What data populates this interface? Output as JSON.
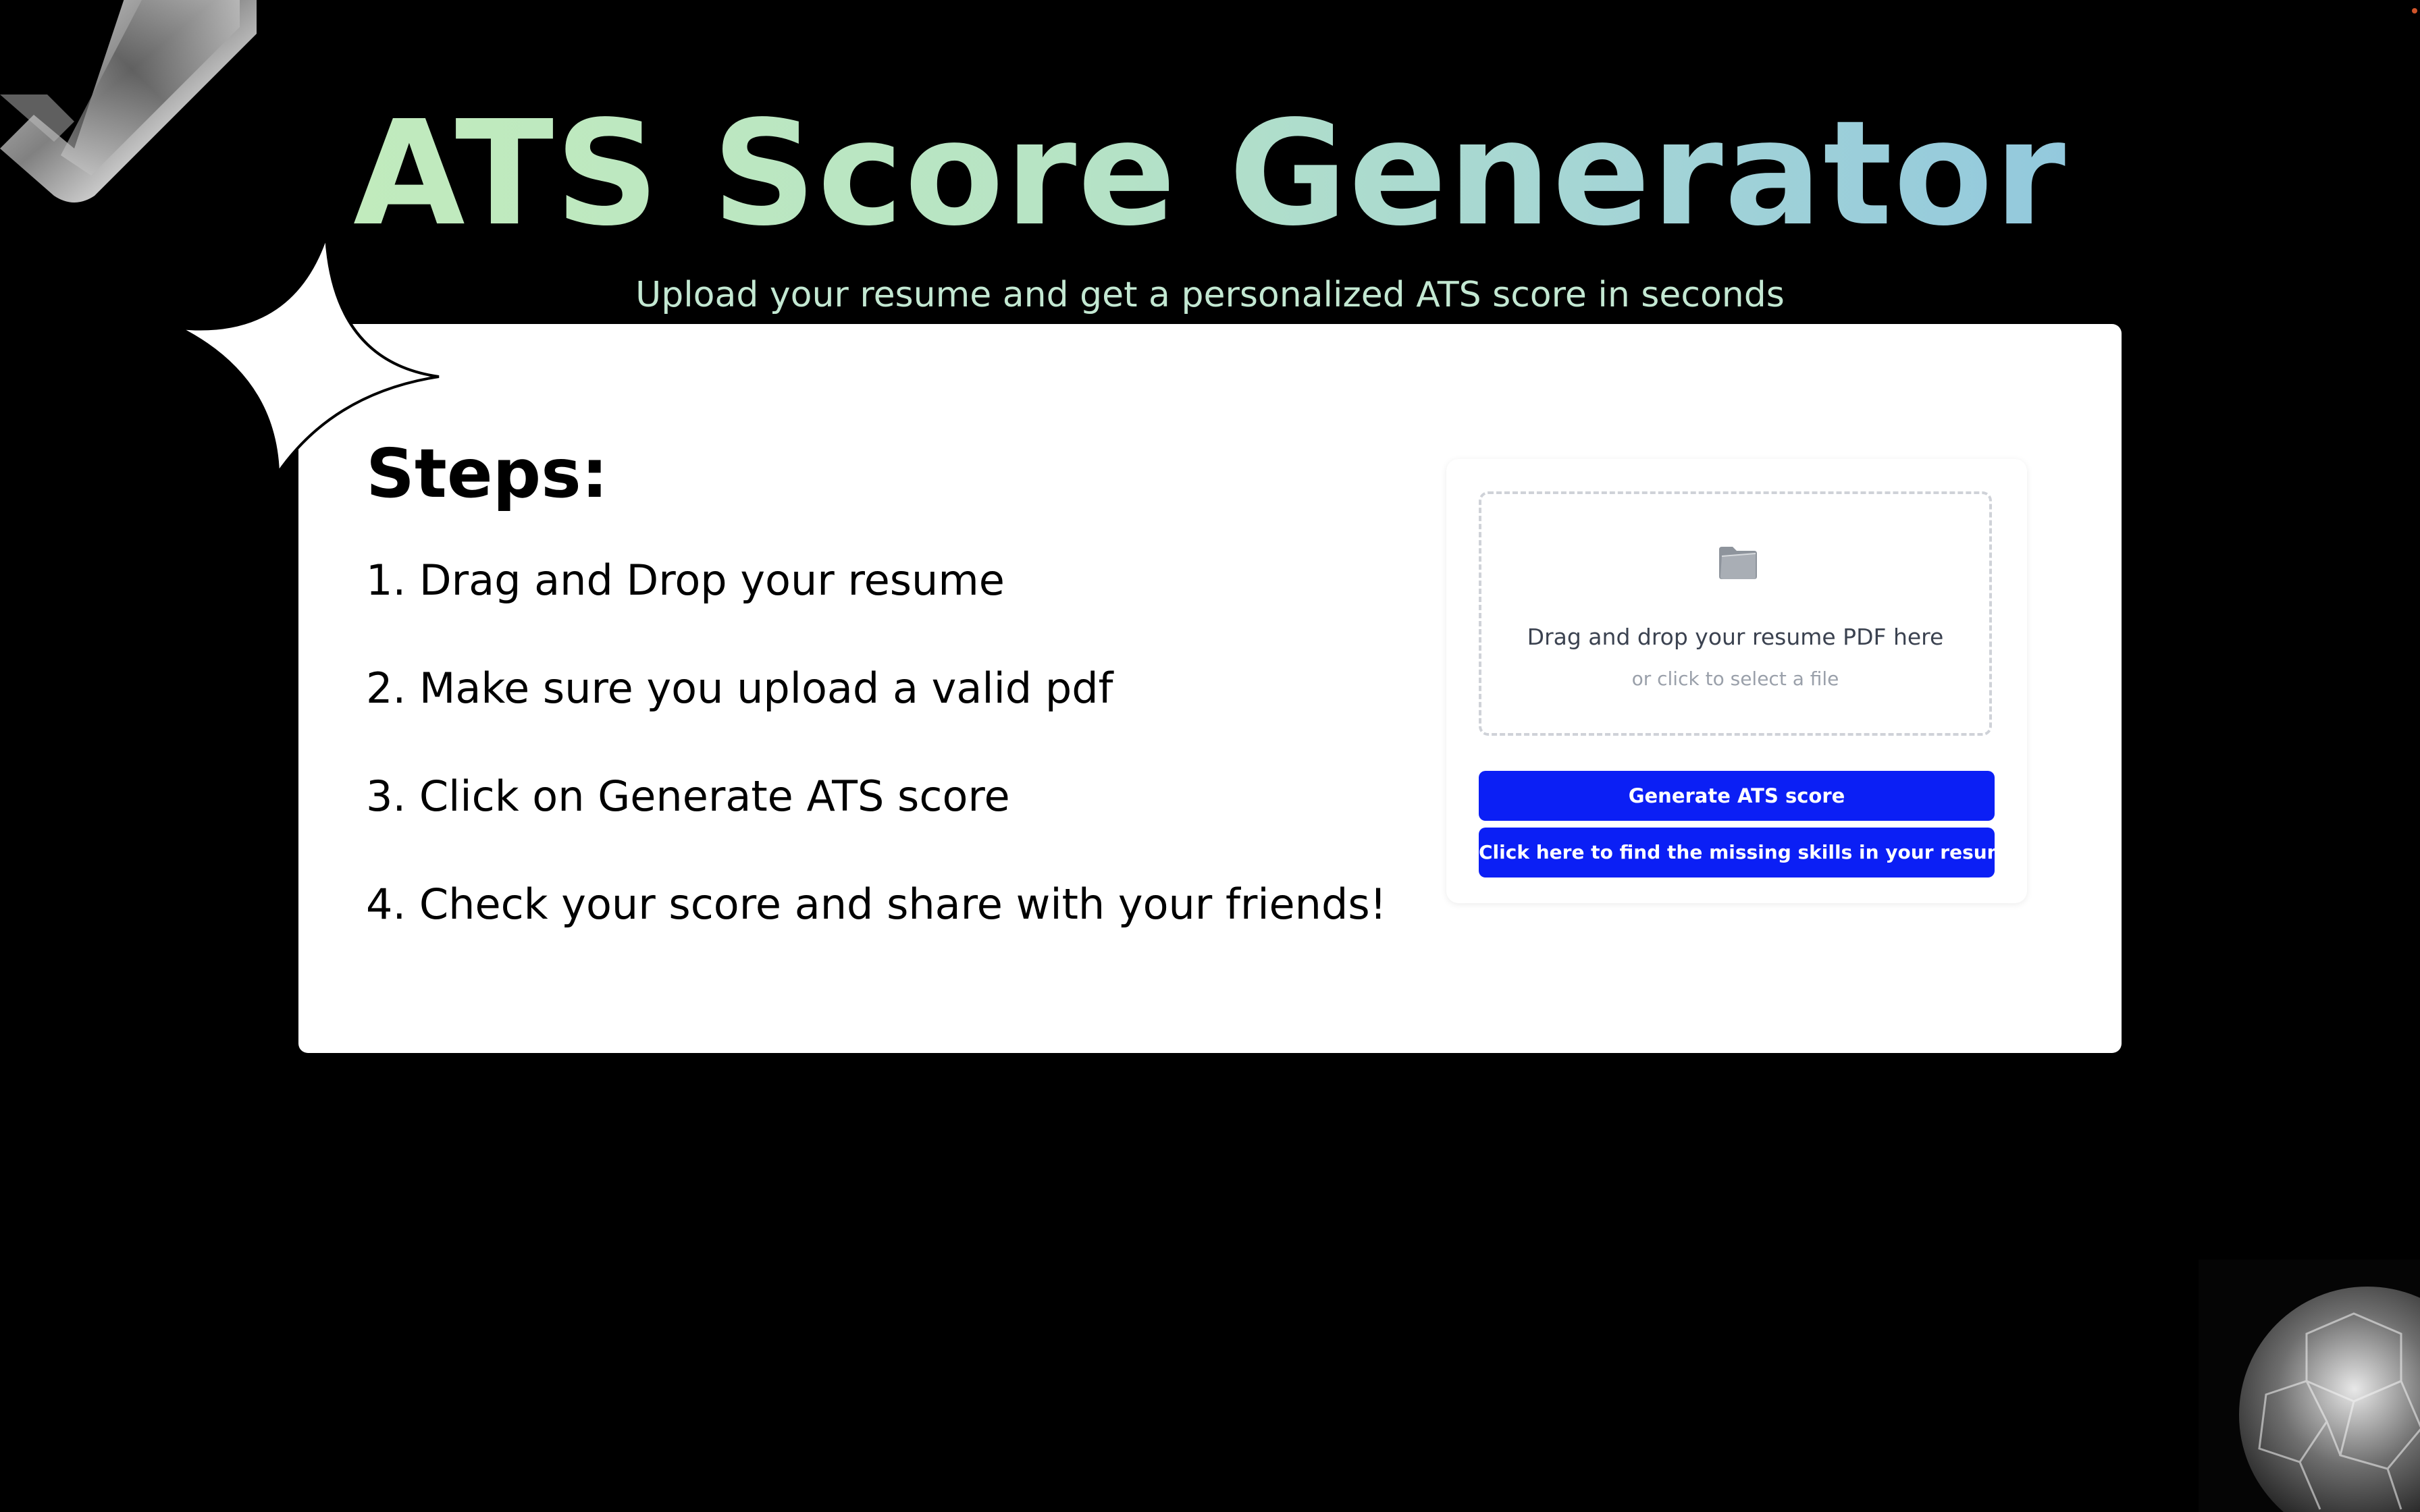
{
  "header": {
    "title": "ATS Score Generator",
    "subtitle": "Upload your resume and get a personalized ATS score in seconds"
  },
  "steps": {
    "heading": "Steps:",
    "items": [
      "1. Drag and Drop your resume",
      "2. Make sure you upload a valid pdf",
      "3. Click on Generate ATS score",
      "4. Check your score and share with your friends!"
    ]
  },
  "upload": {
    "icon": "folder-icon",
    "drop_text": "Drag and drop your resume PDF here",
    "drop_subtext": "or click to select a file"
  },
  "actions": {
    "generate_label": "Generate ATS score",
    "missing_skills_label": "Click here to find the missing skills in your resume"
  },
  "colors": {
    "background": "#000000",
    "card": "#ffffff",
    "button": "#0b1ff5",
    "title_gradient_start": "#c1ebbd",
    "title_gradient_end": "#93c9dd",
    "subtitle": "#c3e8d2"
  }
}
